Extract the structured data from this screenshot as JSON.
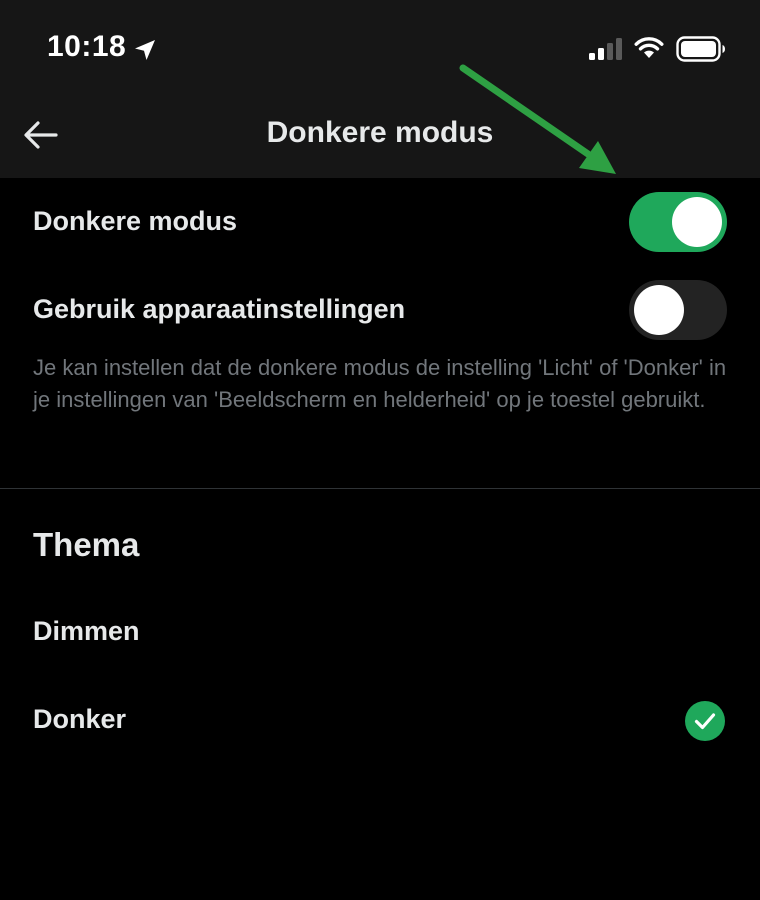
{
  "status_bar": {
    "time": "10:18",
    "icons": [
      "location-arrow-icon",
      "cellular-signal-icon",
      "wifi-icon",
      "battery-icon"
    ]
  },
  "header": {
    "back_icon": "arrow-left-icon",
    "title": "Donkere modus"
  },
  "settings": {
    "dark_mode": {
      "label": "Donkere modus",
      "enabled": true
    },
    "use_device_settings": {
      "label": "Gebruik apparaatinstellingen",
      "enabled": false
    },
    "description": "Je kan instellen dat de donkere modus de instelling 'Licht' of 'Donker' in je instellingen van 'Beeldscherm en helderheid' op je toestel gebruikt."
  },
  "theme": {
    "heading": "Thema",
    "options": [
      {
        "label": "Dimmen",
        "selected": false
      },
      {
        "label": "Donker",
        "selected": true
      }
    ]
  },
  "colors": {
    "background": "#000000",
    "header_background": "#161616",
    "toggle_on": "#1fa85b",
    "toggle_off": "#232323",
    "secondary_text": "#71767b",
    "annotation_arrow": "#2ea043"
  }
}
